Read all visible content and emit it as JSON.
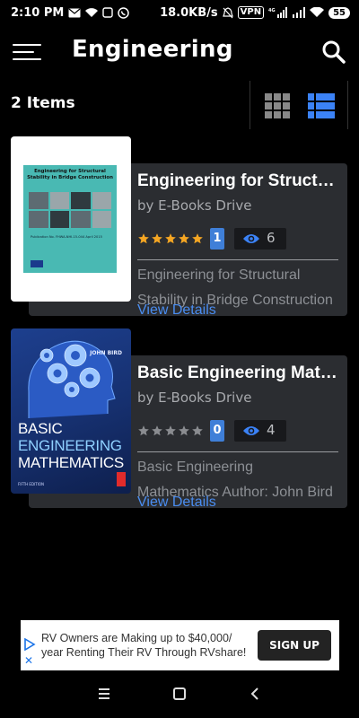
{
  "status_bar": {
    "time": "2:10 PM",
    "network_speed": "18.0KB/s",
    "vpn_label": "VPN",
    "network_type": "4G",
    "battery": "55"
  },
  "header": {
    "title": "Engineering"
  },
  "items_bar": {
    "count_text": "2 Items",
    "active_view": "list"
  },
  "books": [
    {
      "title": "Engineering for Structural Stability in Bridge Construction",
      "author": "by E-Books Drive",
      "rating": 5,
      "rating_count": "1",
      "views": "6",
      "description_lines": [
        "Engineering for Structural",
        "Stability in Bridge Construction"
      ],
      "link_label": "View Details",
      "cover": {
        "title": "Engineering for Structural Stability in Bridge Construction",
        "subtitle": "Publication No. FHWA-NHI-15-044 April 2015"
      }
    },
    {
      "title": "Basic Engineering Mathematics",
      "author": "by E-Books Drive",
      "rating": 0,
      "rating_count": "0",
      "views": "4",
      "description_lines": [
        "Basic Engineering",
        "Mathematics Author: John Bird"
      ],
      "link_label": "View Details",
      "cover": {
        "author": "JOHN BIRD",
        "line1": "BASIC",
        "line2": "ENGINEERING",
        "line3": "MATHEMATICS",
        "edition": "FIFTH EDITION"
      }
    }
  ],
  "ad": {
    "text": "RV Owners are Making up to $40,000/ year Renting Their RV Through RVshare!",
    "cta": "SIGN UP"
  },
  "colors": {
    "accent": "#3b82f6",
    "star_filled": "#f5a623",
    "star_empty": "#8a8c90",
    "card_bg": "#2b2d31"
  }
}
